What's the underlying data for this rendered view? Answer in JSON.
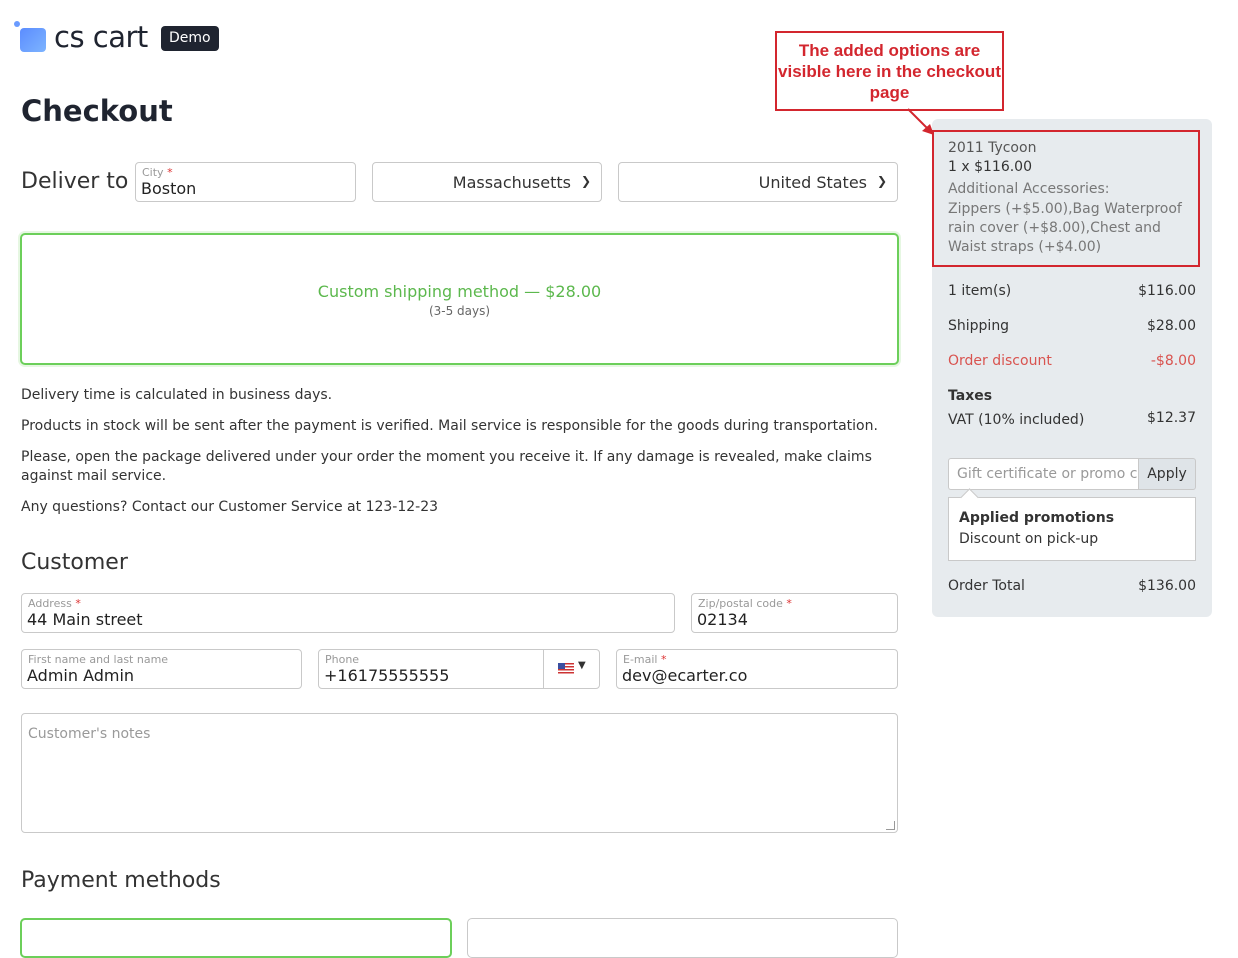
{
  "brand": {
    "name": "cs cart",
    "badge": "Demo"
  },
  "page": {
    "title": "Checkout"
  },
  "delivery": {
    "heading": "Deliver to",
    "city": {
      "label": "City",
      "value": "Boston"
    },
    "state": {
      "value": "Massachusetts"
    },
    "country": {
      "value": "United States"
    }
  },
  "shipping": {
    "method": "Custom shipping method — $28.00",
    "days": "(3-5 days)"
  },
  "info": {
    "line1": "Delivery time is calculated in business days.",
    "line2": "Products in stock will be sent after the payment is verified. Mail service is responsible for the goods during transportation.",
    "line3": "Please, open the package delivered under your order the moment you receive it. If any damage is revealed, make claims against mail service.",
    "line4": "Any questions? Contact our Customer Service at 123-12-23"
  },
  "customer": {
    "heading": "Customer",
    "address": {
      "label": "Address",
      "value": "44 Main street"
    },
    "zip": {
      "label": "Zip/postal code",
      "value": "02134"
    },
    "name": {
      "label": "First name and last name",
      "value": "Admin Admin"
    },
    "phone": {
      "label": "Phone",
      "value": "+16175555555"
    },
    "email": {
      "label": "E-mail",
      "value": "dev@ecarter.co"
    },
    "notes_placeholder": "Customer's notes"
  },
  "payment": {
    "heading": "Payment methods"
  },
  "summary": {
    "product_name": "2011 Tycoon",
    "product_qty_price": "1 x $116.00",
    "accessories_label": "Additional Accessories:",
    "accessories_value": "Zippers (+$5.00),Bag Waterproof rain cover  (+$8.00),Chest and Waist straps (+$4.00)",
    "items_label": "1 item(s)",
    "items_value": "$116.00",
    "shipping_label": "Shipping",
    "shipping_value": "$28.00",
    "discount_label": "Order discount",
    "discount_value": "-$8.00",
    "taxes_heading": "Taxes",
    "vat_label": "VAT (10% included)",
    "vat_value": "$12.37",
    "promo_placeholder": "Gift certificate or promo code",
    "apply_label": "Apply",
    "promotions_heading": "Applied promotions",
    "promotion_item": "Discount on pick-up",
    "total_label": "Order Total",
    "total_value": "$136.00"
  },
  "annotation": {
    "text": "The added options are visible here in the checkout page"
  },
  "colors": {
    "accent_green": "#5cb84d",
    "discount_red": "#d9534f",
    "annotation_red": "#d3262e"
  },
  "icons": [
    "us-flag-icon",
    "chevron-down-icon"
  ]
}
